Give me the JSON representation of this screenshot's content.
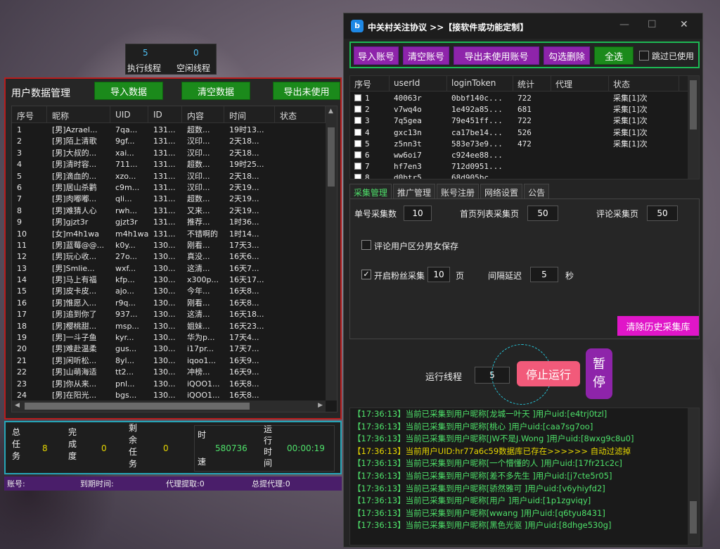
{
  "threads": {
    "exec_value": "5",
    "exec_label": "执行线程",
    "idle_value": "0",
    "idle_label": "空闲线程"
  },
  "user_panel": {
    "title": "用户数据管理",
    "import_btn": "导入数据",
    "clear_btn": "清空数据",
    "export_btn": "导出未使用",
    "columns": [
      "序号",
      "昵称",
      "UID",
      "ID",
      "内容",
      "时间",
      "状态"
    ],
    "rows": [
      [
        "1",
        "[男]Azrael...",
        "7qa...",
        "131...",
        "超数...",
        "19时13..."
      ],
      [
        "2",
        "[男]陌上清歌",
        "9gf...",
        "131...",
        "汉印...",
        "2天18..."
      ],
      [
        "3",
        "[男]大叔的...",
        "xai...",
        "131...",
        "汉印...",
        "2天18..."
      ],
      [
        "4",
        "[男]清时容...",
        "711...",
        "131...",
        "超数...",
        "19时25..."
      ],
      [
        "5",
        "[男]滴血的...",
        "xzo...",
        "131...",
        "汉印...",
        "2天18..."
      ],
      [
        "6",
        "[男]居山杀鹳",
        "c9m...",
        "131...",
        "汉印...",
        "2天19..."
      ],
      [
        "7",
        "[男]肉嘟嘟...",
        "qli...",
        "131...",
        "超数...",
        "2天19..."
      ],
      [
        "8",
        "[男]难猜人心",
        "rwh...",
        "131...",
        "又来...",
        "2天19..."
      ],
      [
        "9",
        "[男]gjzt3r",
        "gjzt3r",
        "131...",
        "推荐...",
        "1时36..."
      ],
      [
        "10",
        "[女]m4h1wa",
        "m4h1wa",
        "131...",
        "不错啊的",
        "1时14..."
      ],
      [
        "11",
        "[男]蓝莓@@...",
        "k0y...",
        "130...",
        "刚看...",
        "17天3..."
      ],
      [
        "12",
        "[男]玩心收...",
        "27o...",
        "130...",
        "真没...",
        "16天6..."
      ],
      [
        "13",
        "[男]Smlie...",
        "wxf...",
        "130...",
        "这清...",
        "16天7..."
      ],
      [
        "14",
        "[男]马上有福",
        "kfp...",
        "130...",
        "x300p...",
        "16天17..."
      ],
      [
        "15",
        "[男]皮卡皮...",
        "ajo...",
        "130...",
        "今年...",
        "16天8..."
      ],
      [
        "16",
        "[男]惟愿入...",
        "r9q...",
        "130...",
        "刚看...",
        "16天8..."
      ],
      [
        "17",
        "[男]追到你了",
        "937...",
        "130...",
        "这清...",
        "16天18..."
      ],
      [
        "18",
        "[男]樱桃甜...",
        "msp...",
        "130...",
        "姐妹...",
        "16天23..."
      ],
      [
        "19",
        "[男]一斗子鱼",
        "kyr...",
        "130...",
        "华为p...",
        "17天4..."
      ],
      [
        "20",
        "[男]难赴温柔",
        "gus...",
        "130...",
        "i17pr...",
        "17天7..."
      ],
      [
        "21",
        "[男]闲听松...",
        "8yl...",
        "130...",
        "iqoo1...",
        "16天9..."
      ],
      [
        "22",
        "[男]山萌海适",
        "tt2...",
        "130...",
        "冲榜...",
        "16天9..."
      ],
      [
        "23",
        "[男]你从来...",
        "pnl...",
        "130...",
        "iQOO1...",
        "16天8..."
      ],
      [
        "24",
        "[男]在阳光...",
        "bgs...",
        "130...",
        "iQOO1...",
        "16天8..."
      ]
    ]
  },
  "stats": {
    "total_label": "总任务",
    "total_value": "8",
    "done_label": "完成度",
    "done_value": "0",
    "remain_label": "剩余任务",
    "remain_value": "0",
    "speed_label_1": "时",
    "speed_label_2": "速",
    "speed_value": "580736",
    "runtime_label": "运行时间",
    "runtime_value": "00:00:19"
  },
  "status_bar": {
    "account": "账号:",
    "expiry": "到期时间:",
    "proxy_fetch": "代理提取:0",
    "total_proxy": "总提代理:0"
  },
  "window": {
    "title": "中关村关注协议 >>【接软件或功能定制】",
    "logo": "b"
  },
  "toolbar": {
    "import_account": "导入账号",
    "clear_account": "清空账号",
    "export_unused": "导出未使用账号",
    "delete_checked": "勾选删除",
    "select_all": "全选",
    "skip_used": "跳过已使用"
  },
  "accounts": {
    "columns": [
      "序号",
      "userId",
      "loginToken",
      "统计",
      "代理",
      "状态"
    ],
    "rows": [
      [
        "1",
        "40063r",
        "0bbf140c...",
        "722",
        "",
        "采集[1]次"
      ],
      [
        "2",
        "v7wq4o",
        "1e492a85...",
        "681",
        "",
        "采集[1]次"
      ],
      [
        "3",
        "7q5gea",
        "79e451ff...",
        "722",
        "",
        "采集[1]次"
      ],
      [
        "4",
        "gxc13n",
        "ca17be14...",
        "526",
        "",
        "采集[1]次"
      ],
      [
        "5",
        "z5nn3t",
        "583e73e9...",
        "472",
        "",
        "采集[1]次"
      ],
      [
        "6",
        "ww6oi7",
        "c924ee88...",
        "",
        "",
        ""
      ],
      [
        "7",
        "hf7en3",
        "712d0951...",
        "",
        "",
        ""
      ],
      [
        "8",
        "d0btr5",
        "68d905bc...",
        "",
        "",
        ""
      ]
    ]
  },
  "tabs": [
    "采集管理",
    "推广管理",
    "账号注册",
    "网络设置",
    "公告"
  ],
  "settings": {
    "single_label": "单号采集数",
    "single_value": "10",
    "home_label": "首页列表采集页",
    "home_value": "50",
    "comment_label": "评论采集页",
    "comment_value": "50",
    "gender_label": "评论用户区分男女保存",
    "fans_label": "开启粉丝采集",
    "fans_value": "10",
    "fans_unit": "页",
    "delay_label": "间隔延迟",
    "delay_value": "5",
    "delay_unit": "秒",
    "clear_history": "清除历史采集库"
  },
  "run": {
    "thread_label": "运行线程",
    "thread_value": "5",
    "stop": "停止运行",
    "pause_1": "暂",
    "pause_2": "停"
  },
  "log": [
    {
      "text": "【17:36:13】当前已采集到用户昵称[龙城一叶天 ]用户uid:[e4trj0tzl]",
      "warn": false
    },
    {
      "text": "【17:36:13】当前已采集到用户昵称[桃心 ]用户uid:[caa7sg7oo]",
      "warn": false
    },
    {
      "text": "【17:36:13】当前已采集到用户昵称[JW不是J.Wong ]用户uid:[8wxg9c8u0]",
      "warn": false
    },
    {
      "text": "【17:36:13】当前用户UID:hr77a6c59数据库已存在>>>>>> 自动过滤掉",
      "warn": true
    },
    {
      "text": "【17:36:13】当前已采集到用户昵称[一个懵懂的人 ]用户uid:[17fr21c2c]",
      "warn": false
    },
    {
      "text": "【17:36:13】当前已采集到用户昵称[差不多先生 ]用户uid:[j7cte5r05]",
      "warn": false
    },
    {
      "text": "【17:36:13】当前已采集到用户昵称[骄然雅可 ]用户uid:[v6yhiyfd2]",
      "warn": false
    },
    {
      "text": "【17:36:13】当前已采集到用户昵称[用户 ]用户uid:[1p1zgviqy]",
      "warn": false
    },
    {
      "text": "【17:36:13】当前已采集到用户昵称[wwang ]用户uid:[q6tyu8431]",
      "warn": false
    },
    {
      "text": "【17:36:13】当前已采集到用户昵称[黑色光驱 ]用户uid:[8dhge530g]",
      "warn": false
    }
  ]
}
